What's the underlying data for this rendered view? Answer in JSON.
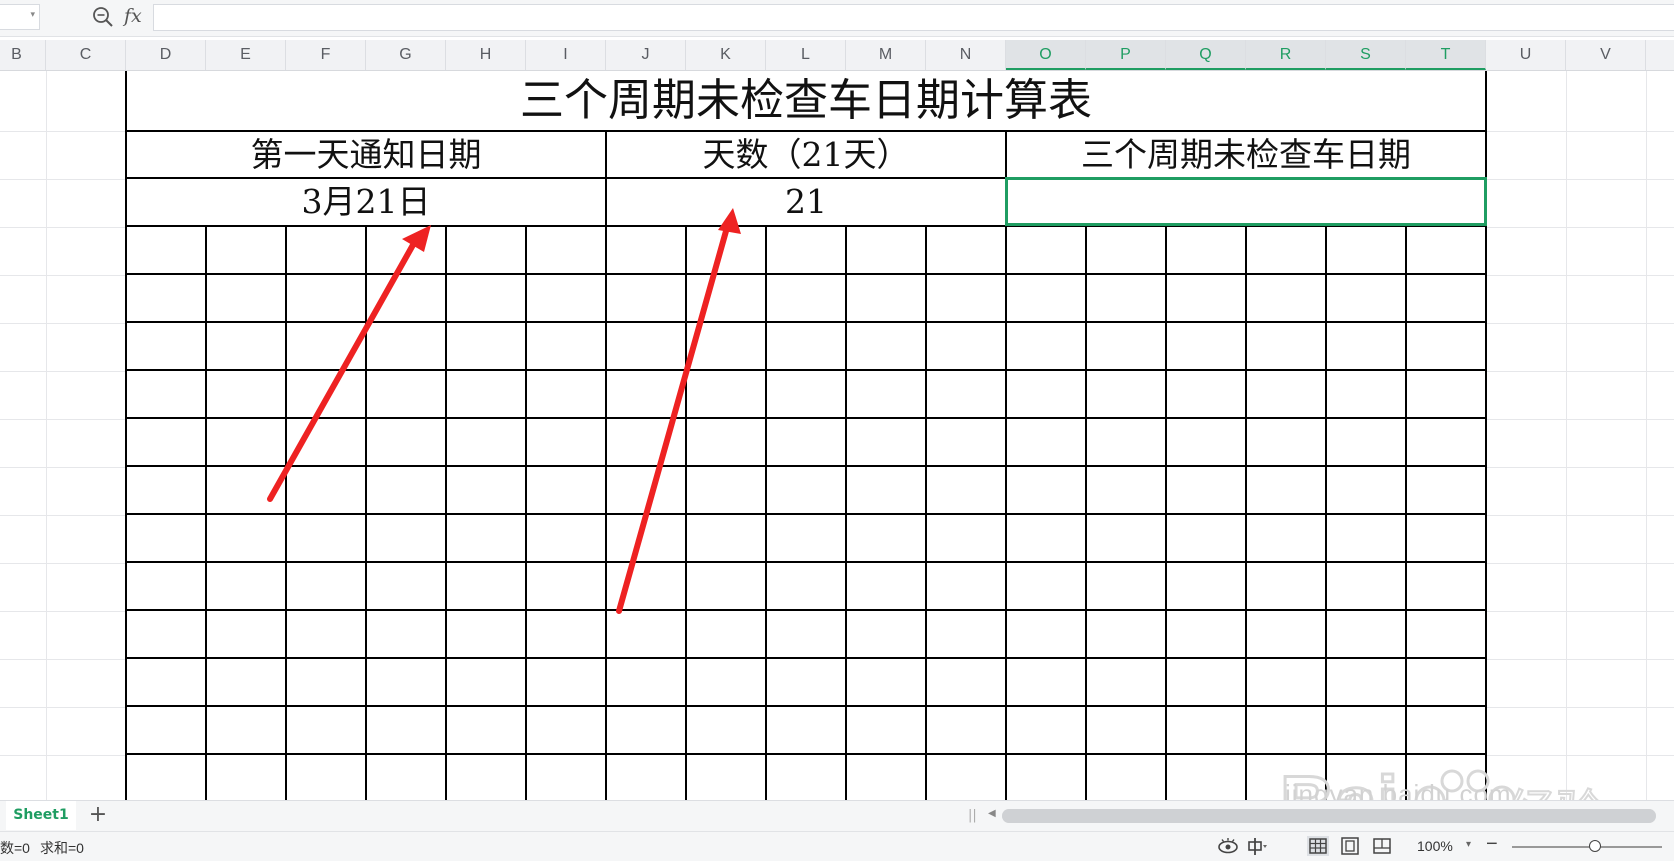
{
  "formula_bar": {
    "fx_label": "fx",
    "formula_value": ""
  },
  "columns": [
    "B",
    "C",
    "D",
    "E",
    "F",
    "G",
    "H",
    "I",
    "J",
    "K",
    "L",
    "M",
    "N",
    "O",
    "P",
    "Q",
    "R",
    "S",
    "T",
    "U",
    "V"
  ],
  "selected_columns": [
    "O",
    "P",
    "Q",
    "R",
    "S",
    "T"
  ],
  "table": {
    "title": "三个周期未检查车日期计算表",
    "headers": [
      "第一天通知日期",
      "天数（21天）",
      "三个周期未检查车日期"
    ],
    "values": [
      "3月21日",
      "21",
      ""
    ]
  },
  "annotation_color": "#ee2222",
  "accent_color": "#1f9d62",
  "sheet_tabs": {
    "active": "Sheet1",
    "add_label": "+"
  },
  "status_bar": {
    "count": "数=0",
    "sum": "求和=0",
    "zoom": "100%"
  },
  "watermark": {
    "url": "jingyan.baidu.com"
  }
}
